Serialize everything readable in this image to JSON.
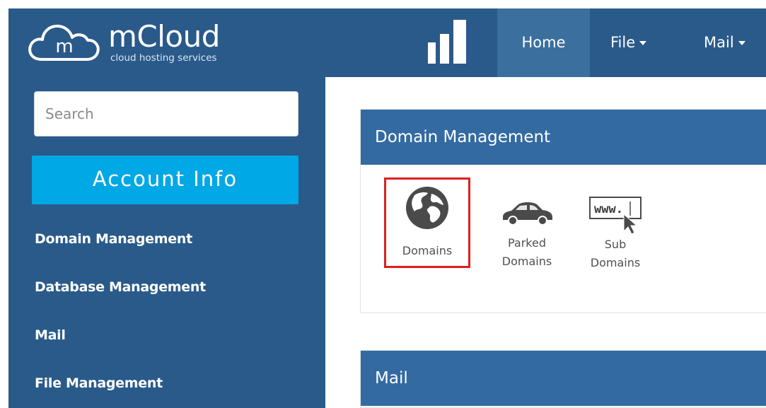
{
  "header": {
    "brand_name": "mCloud",
    "brand_tagline": "cloud hosting services",
    "brand_mark": "m",
    "nav": [
      {
        "label": "Home",
        "active": true
      },
      {
        "label": "File",
        "dropdown": true
      },
      {
        "label": "Mail",
        "dropdown": true
      }
    ]
  },
  "sidebar": {
    "search_placeholder": "Search",
    "account_button": "Account Info",
    "links": [
      "Domain Management",
      "Database Management",
      "Mail",
      "File Management"
    ]
  },
  "main": {
    "panels": [
      {
        "title": "Domain Management",
        "tiles": [
          {
            "label": "Domains",
            "icon": "globe-icon",
            "highlighted": true
          },
          {
            "label_line1": "Parked",
            "label_line2": "Domains",
            "icon": "car-icon"
          },
          {
            "label_line1": "Sub",
            "label_line2": "Domains",
            "icon": "www-cursor-icon"
          }
        ]
      },
      {
        "title": "Mail"
      }
    ]
  },
  "colors": {
    "header_bg": "#2a5a8a",
    "nav_active_bg": "#3b6f9e",
    "account_button_bg": "#00a8e6",
    "panel_header_bg": "#336aa2",
    "highlight_border": "#e01e1e"
  }
}
